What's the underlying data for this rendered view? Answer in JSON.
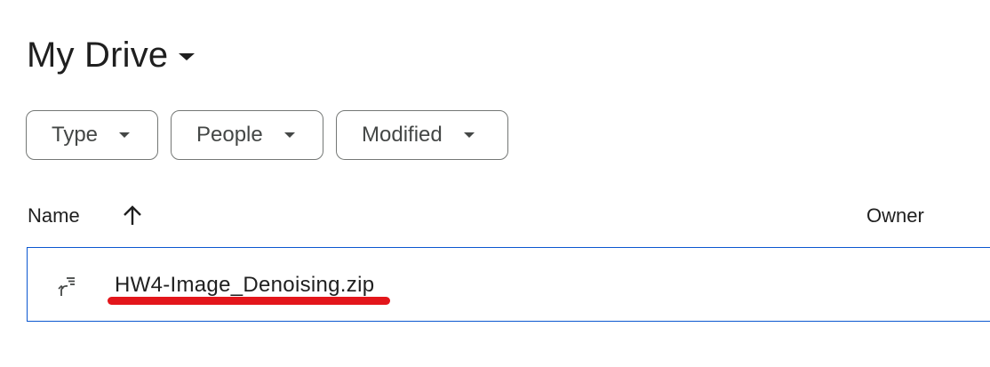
{
  "header": {
    "title": "My Drive",
    "title_menu_icon": "caret-down-icon"
  },
  "filters": [
    {
      "label": "Type",
      "icon": "caret-down-icon"
    },
    {
      "label": "People",
      "icon": "caret-down-icon"
    },
    {
      "label": "Modified",
      "icon": "caret-down-icon"
    }
  ],
  "columns": {
    "name": "Name",
    "sort_icon": "arrow-up-icon",
    "owner": "Owner"
  },
  "files": [
    {
      "name": "HW4-Image_Denoising.zip",
      "icon": "zip-file-icon",
      "annotation_color": "#e3161b"
    }
  ],
  "colors": {
    "selection_border": "#0b57d0",
    "chip_border": "#747775",
    "annotation": "#e3161b"
  }
}
